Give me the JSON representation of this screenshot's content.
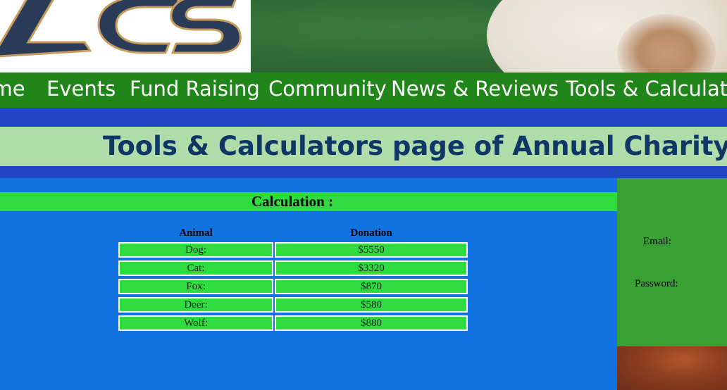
{
  "logo": {
    "text": "ACS"
  },
  "nav": {
    "items": [
      {
        "label": "Home"
      },
      {
        "label": "Events"
      },
      {
        "label": "Fund Raising"
      },
      {
        "label": "Community"
      },
      {
        "label": "News & Reviews"
      },
      {
        "label": "Tools & Calculators"
      }
    ]
  },
  "page_title": "Tools & Calculators page of Annual Charity Show",
  "calculation": {
    "heading": "Calculation :",
    "columns": [
      "Animal",
      "Donation"
    ],
    "rows": [
      {
        "animal": "Dog:",
        "donation": "$5550"
      },
      {
        "animal": "Cat:",
        "donation": "$3320"
      },
      {
        "animal": "Fox:",
        "donation": "$870"
      },
      {
        "animal": "Deer:",
        "donation": "$580"
      },
      {
        "animal": "Wolf:",
        "donation": "$880"
      }
    ]
  },
  "login": {
    "email_label": "Email:",
    "password_label": "Password:"
  },
  "colors": {
    "nav_green": "#21861a",
    "main_blue": "#1173e2",
    "title_navy": "#0f3766",
    "cell_green": "#2fdc3f"
  }
}
